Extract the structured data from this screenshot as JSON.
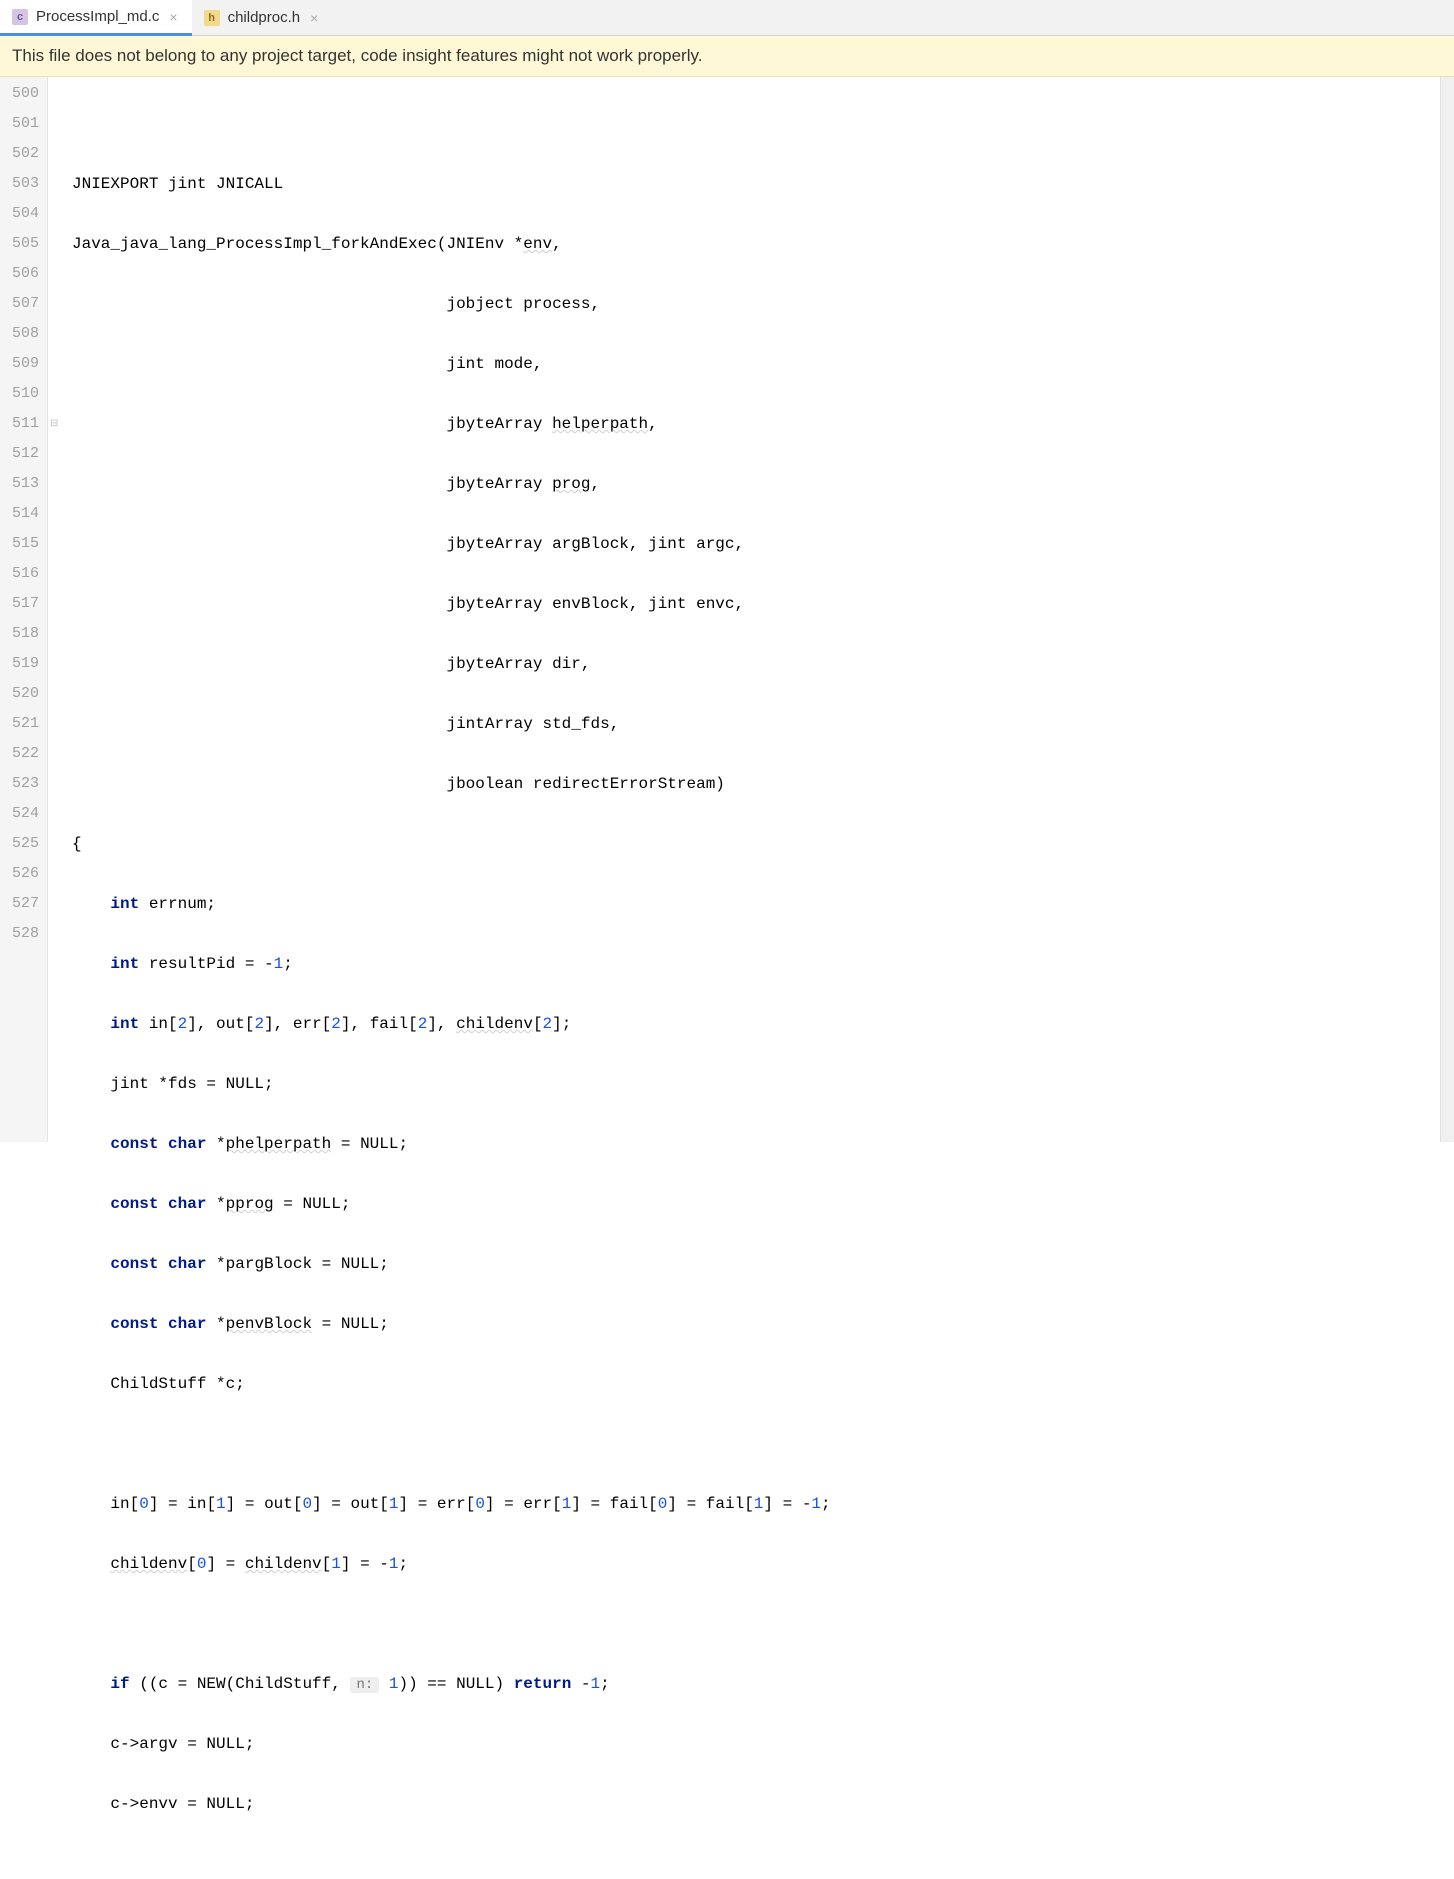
{
  "tabs": [
    {
      "label": "ProcessImpl_md.c",
      "icon": "c",
      "active": true
    },
    {
      "label": "childproc.h",
      "icon": "h",
      "active": false
    }
  ],
  "warning": "This file does not belong to any project target, code insight features might not work properly.",
  "lines": {
    "start": 500,
    "end": 528
  },
  "hint_526": "n:",
  "code": {
    "l500": "",
    "l501_a": "JNIEXPORT jint JNICALL",
    "l502_a": "Java_java_lang_ProcessImpl_forkAndExec",
    "l502_b": "(JNIEnv *",
    "l502_c": "env",
    "l502_d": ",",
    "l503_a": "                                       jobject process,",
    "l504_a": "                                       jint mode,",
    "l505_a": "                                       jbyteArray ",
    "l505_b": "helperpath",
    "l505_c": ",",
    "l506_a": "                                       jbyteArray ",
    "l506_b": "prog",
    "l506_c": ",",
    "l507_a": "                                       jbyteArray argBlock, jint argc,",
    "l508_a": "                                       jbyteArray envBlock, jint envc,",
    "l509_a": "                                       jbyteArray dir,",
    "l510_a": "                                       jintArray std_fds,",
    "l511_a": "                                       jboolean redirectErrorStream)",
    "l512_a": "{",
    "l513_int": "int",
    "l513_a": " errnum;",
    "l514_int": "int",
    "l514_a": " resultPid = -",
    "l514_n": "1",
    "l514_b": ";",
    "l515_int": "int",
    "l515_a": " in[",
    "l515_n1": "2",
    "l515_b": "], out[",
    "l515_n2": "2",
    "l515_c": "], err[",
    "l515_n3": "2",
    "l515_d": "], fail[",
    "l515_n4": "2",
    "l515_e": "], ",
    "l515_f": "childenv",
    "l515_g": "[",
    "l515_n5": "2",
    "l515_h": "];",
    "l516_a": "    jint *fds = NULL;",
    "l517_const": "const",
    "l517_char": "char",
    "l517_a": " *",
    "l517_b": "phelperpath",
    "l517_c": " = NULL;",
    "l518_const": "const",
    "l518_char": "char",
    "l518_a": " *",
    "l518_b": "pprog",
    "l518_c": " = NULL;",
    "l519_const": "const",
    "l519_char": "char",
    "l519_a": " *pargBlock = NULL;",
    "l520_const": "const",
    "l520_char": "char",
    "l520_a": " *",
    "l520_b": "penvBlock",
    "l520_c": " = NULL;",
    "l521_a": "    ChildStuff *c;",
    "l522_a": "",
    "l523_a": "    in[",
    "l523_n1": "0",
    "l523_b": "] = in[",
    "l523_n2": "1",
    "l523_c": "] = out[",
    "l523_n3": "0",
    "l523_d": "] = out[",
    "l523_n4": "1",
    "l523_e": "] = err[",
    "l523_n5": "0",
    "l523_f": "] = err[",
    "l523_n6": "1",
    "l523_g": "] = fail[",
    "l523_n7": "0",
    "l523_h": "] = fail[",
    "l523_n8": "1",
    "l523_i": "] = -",
    "l523_n9": "1",
    "l523_j": ";",
    "l524_a": "    ",
    "l524_b": "childenv",
    "l524_c": "[",
    "l524_n1": "0",
    "l524_d": "] = ",
    "l524_e": "childenv",
    "l524_f": "[",
    "l524_n2": "1",
    "l524_g": "] = -",
    "l524_n3": "1",
    "l524_h": ";",
    "l525_a": "",
    "l526_if": "if",
    "l526_a": " ((c = NEW(ChildStuff, ",
    "l526_n1": "1",
    "l526_b": ")) == NULL) ",
    "l526_return": "return",
    "l526_c": " -",
    "l526_n2": "1",
    "l526_d": ";",
    "l527_a": "    c->argv = NULL;",
    "l528_a": "    c->envv = NULL;"
  }
}
